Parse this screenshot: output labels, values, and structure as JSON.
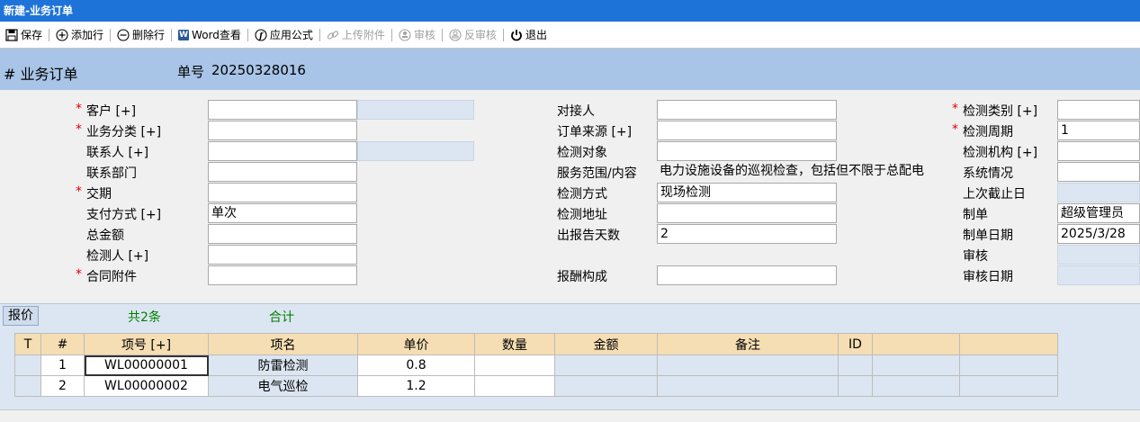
{
  "window": {
    "title": "新建-业务订单"
  },
  "toolbar": {
    "save": "保存",
    "add_row": "添加行",
    "delete_row": "删除行",
    "word_view": "Word查看",
    "apply_formula": "应用公式",
    "upload": "上传附件",
    "audit": "审核",
    "unaudit": "反审核",
    "exit": "退出"
  },
  "header": {
    "title": "# 业务订单",
    "doc_no_label": "单号",
    "doc_no": "20250328016"
  },
  "form": {
    "col1": [
      {
        "label": "客户 [+]",
        "value": "",
        "required": true
      },
      {
        "label": "业务分类 [+]",
        "value": "",
        "required": true
      },
      {
        "label": "联系人 [+]",
        "value": "",
        "required": false
      },
      {
        "label": "联系部门",
        "value": "",
        "required": false
      },
      {
        "label": "交期",
        "value": "",
        "required": true
      },
      {
        "label": "支付方式 [+]",
        "value": "单次",
        "required": false
      },
      {
        "label": "总金额",
        "value": "",
        "required": false
      },
      {
        "label": "检测人 [+]",
        "value": "",
        "required": false
      },
      {
        "label": "合同附件",
        "value": "",
        "required": true
      }
    ],
    "col2": [
      {
        "label": "对接人",
        "value": ""
      },
      {
        "label": "订单来源 [+]",
        "value": ""
      },
      {
        "label": "检测对象",
        "value": ""
      },
      {
        "label": "服务范围/内容",
        "value": "电力设施设备的巡视检查，包括但不限于总配电"
      },
      {
        "label": "检测方式",
        "value": "现场检测"
      },
      {
        "label": "检测地址",
        "value": ""
      },
      {
        "label": "出报告天数",
        "value": "2"
      },
      {
        "label": "报酬构成",
        "value": ""
      }
    ],
    "col3": [
      {
        "label": "检测类别 [+]",
        "value": "",
        "required": true
      },
      {
        "label": "检测周期",
        "value": "1",
        "required": true
      },
      {
        "label": "检测机构 [+]",
        "value": "",
        "required": false
      },
      {
        "label": "系统情况",
        "value": "",
        "required": false
      },
      {
        "label": "上次截止日",
        "value": "",
        "required": false
      },
      {
        "label": "制单",
        "value": "超级管理员",
        "required": false
      },
      {
        "label": "制单日期",
        "value": "2025/3/28",
        "required": false
      },
      {
        "label": "审核",
        "value": "",
        "required": false
      },
      {
        "label": "审核日期",
        "value": "",
        "required": false
      }
    ],
    "required_mark": "*"
  },
  "grid": {
    "tab_label": "报价",
    "count_text": "共2条",
    "sum_text": "合计",
    "columns": [
      "T",
      "#",
      "项号 [+]",
      "项名",
      "单价",
      "数量",
      "金额",
      "备注",
      "ID",
      "",
      ""
    ],
    "rows": [
      {
        "t": "",
        "no": "1",
        "code": "WL00000001",
        "name": "防雷检测",
        "price": "0.8",
        "qty": "",
        "amount": "",
        "note": "",
        "id": ""
      },
      {
        "t": "",
        "no": "2",
        "code": "WL00000002",
        "name": "电气巡检",
        "price": "1.2",
        "qty": "",
        "amount": "",
        "note": "",
        "id": ""
      }
    ]
  }
}
